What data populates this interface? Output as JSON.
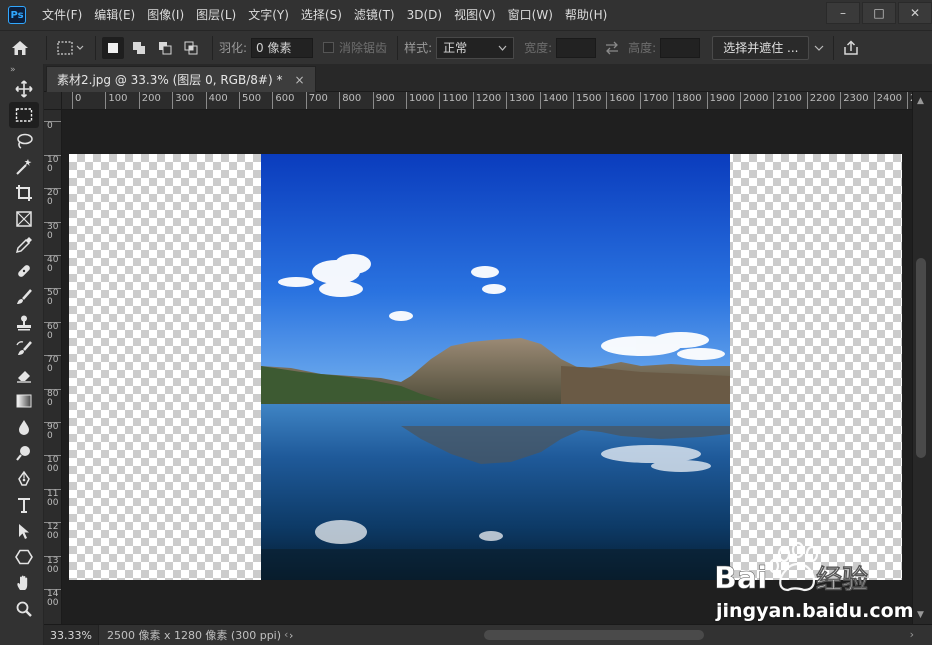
{
  "app": {
    "logo_text": "Ps"
  },
  "menubar": {
    "items": [
      "文件(F)",
      "编辑(E)",
      "图像(I)",
      "图层(L)",
      "文字(Y)",
      "选择(S)",
      "滤镜(T)",
      "3D(D)",
      "视图(V)",
      "窗口(W)",
      "帮助(H)"
    ]
  },
  "window_controls": {
    "minimize": "–",
    "maximize": "□",
    "close": "✕"
  },
  "options": {
    "feather_label": "羽化:",
    "feather_value": "0 像素",
    "antialias_label": "消除锯齿",
    "style_label": "样式:",
    "style_value": "正常",
    "width_label": "宽度:",
    "height_label": "高度:",
    "select_mask_label": "选择并遮住 ..."
  },
  "document": {
    "tab_title": "素材2.jpg @ 33.3% (图层 0, RGB/8#) *",
    "tab_close": "×"
  },
  "ruler": {
    "h_labels": [
      "0",
      "100",
      "200",
      "300",
      "400",
      "500",
      "600",
      "700",
      "800",
      "900",
      "1000",
      "1100",
      "1200",
      "1300",
      "1400",
      "1500",
      "1600",
      "1700",
      "1800",
      "1900",
      "2000",
      "2100",
      "2200",
      "2300",
      "2400",
      "2"
    ],
    "v_labels": [
      "100",
      "0",
      "100",
      "200",
      "300",
      "400",
      "500",
      "600",
      "700",
      "800",
      "900",
      "1000",
      "1100",
      "1200",
      "1300",
      "1400"
    ]
  },
  "status": {
    "zoom": "33.33%",
    "doc_info": "2500 像素 x 1280 像素 (300 ppi)",
    "arrow": "›"
  },
  "watermark": {
    "brand": "Bai du 经验",
    "url": "jingyan.baidu.com"
  },
  "colors": {
    "ps_blue": "#31a8ff",
    "panel": "#323232",
    "canvas_bg": "#1f1f1f"
  }
}
